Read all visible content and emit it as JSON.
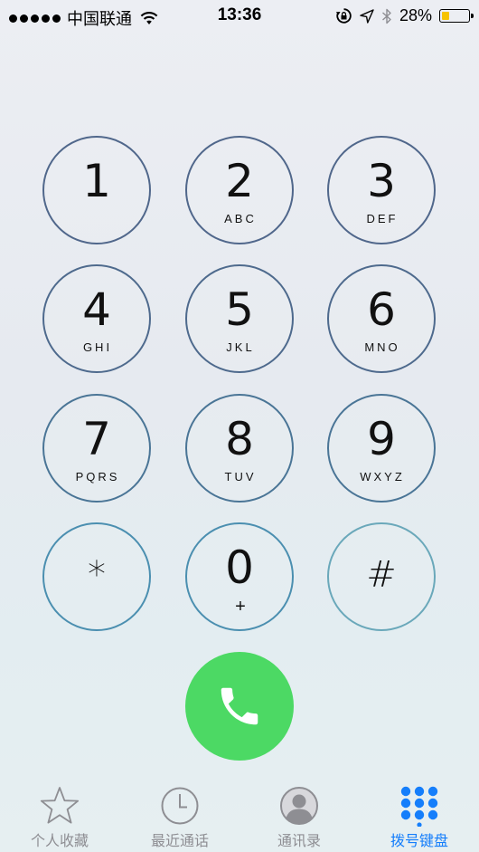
{
  "status_bar": {
    "carrier": "中国联通",
    "time": "13:36",
    "battery_percent": "28%",
    "battery_level": 0.28,
    "battery_color": "#f6c300",
    "icons": [
      "signal-dots-icon",
      "wifi-icon",
      "rotation-lock-icon",
      "location-arrow-icon",
      "bluetooth-icon",
      "battery-icon"
    ]
  },
  "keypad": {
    "keys": [
      {
        "digit": "1",
        "letters": ""
      },
      {
        "digit": "2",
        "letters": "ABC"
      },
      {
        "digit": "3",
        "letters": "DEF"
      },
      {
        "digit": "4",
        "letters": "GHI"
      },
      {
        "digit": "5",
        "letters": "JKL"
      },
      {
        "digit": "6",
        "letters": "MNO"
      },
      {
        "digit": "7",
        "letters": "PQRS"
      },
      {
        "digit": "8",
        "letters": "TUV"
      },
      {
        "digit": "9",
        "letters": "WXYZ"
      },
      {
        "digit": "*",
        "letters": ""
      },
      {
        "digit": "0",
        "letters": "+"
      },
      {
        "digit": "#",
        "letters": ""
      }
    ],
    "call_icon": "phone-icon",
    "call_color": "#4cd964"
  },
  "tabbar": {
    "tabs": [
      {
        "label": "个人收藏",
        "icon": "star-icon",
        "active": false
      },
      {
        "label": "最近通话",
        "icon": "clock-icon",
        "active": false
      },
      {
        "label": "通讯录",
        "icon": "contact-icon",
        "active": false
      },
      {
        "label": "拨号键盘",
        "icon": "keypad-icon",
        "active": true
      }
    ],
    "active_color": "#157efb",
    "inactive_color": "#8e8e93"
  }
}
